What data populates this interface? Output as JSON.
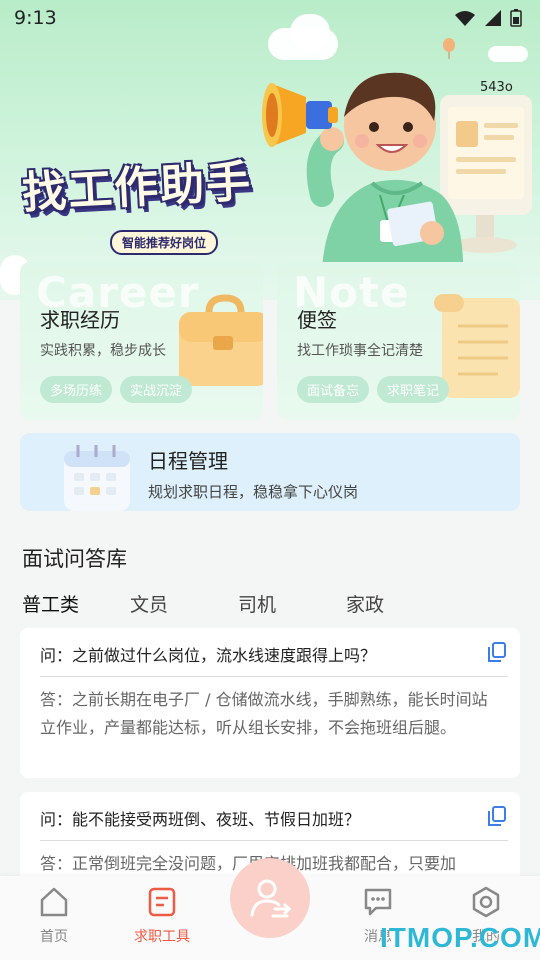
{
  "status_bar": {
    "time": "9:13"
  },
  "hero": {
    "counter": "543o",
    "title": "找工作助手",
    "subtitle": "智能推荐好岗位"
  },
  "cards": {
    "career": {
      "watermark": "Career",
      "title": "求职经历",
      "desc": "实践积累，稳步成长",
      "tags": [
        "多场历练",
        "实战沉淀"
      ]
    },
    "note": {
      "watermark": "Note",
      "title": "便签",
      "desc": "找工作琐事全记清楚",
      "tags": [
        "面试备忘",
        "求职笔记"
      ]
    },
    "schedule": {
      "title": "日程管理",
      "desc": "规划求职日程，稳稳拿下心仪岗"
    }
  },
  "qa_section": {
    "title": "面试问答库",
    "categories": [
      "普工类",
      "文员",
      "司机",
      "家政"
    ],
    "items": [
      {
        "question": "问：之前做过什么岗位，流水线速度跟得上吗？",
        "answer": "答：之前长期在电子厂 / 仓储做流水线，手脚熟练，能长时间站立作业，产量都能达标，听从组长安排，不会拖班组后腿。"
      },
      {
        "question": "问：能不能接受两班倒、夜班、节假日加班？",
        "answer": "答：正常倒班完全没问题，厂里安排加班我都配合，只要加"
      }
    ]
  },
  "bottom_nav": {
    "items": [
      "首页",
      "求职工具",
      "消息",
      "我的"
    ]
  },
  "brand": "ITMOP.COM",
  "colors": {
    "accent": "#ee5b43",
    "green_bg": "#cdf3da",
    "blue_card": "#def0fb"
  }
}
